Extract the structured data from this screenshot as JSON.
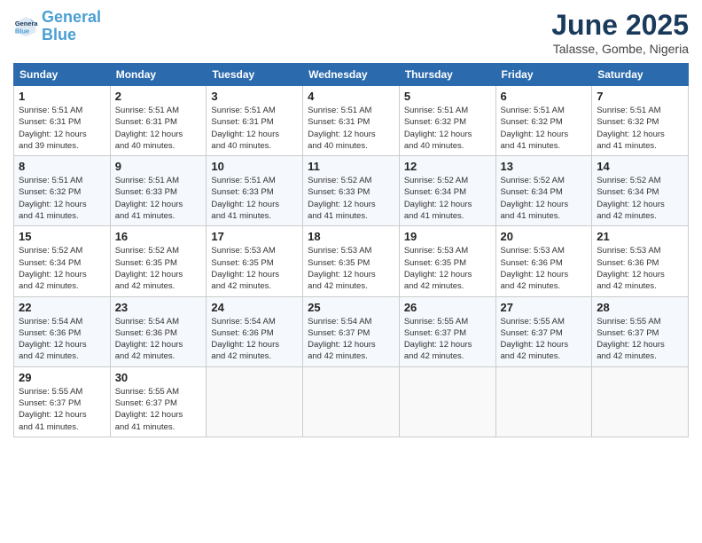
{
  "header": {
    "logo_line1": "General",
    "logo_line2": "Blue",
    "month": "June 2025",
    "location": "Talasse, Gombe, Nigeria"
  },
  "weekdays": [
    "Sunday",
    "Monday",
    "Tuesday",
    "Wednesday",
    "Thursday",
    "Friday",
    "Saturday"
  ],
  "days": [
    {
      "num": "",
      "info": ""
    },
    {
      "num": "",
      "info": ""
    },
    {
      "num": "",
      "info": ""
    },
    {
      "num": "",
      "info": ""
    },
    {
      "num": "",
      "info": ""
    },
    {
      "num": "",
      "info": ""
    },
    {
      "num": "",
      "info": ""
    },
    {
      "num": "1",
      "info": "Sunrise: 5:51 AM\nSunset: 6:31 PM\nDaylight: 12 hours\nand 39 minutes."
    },
    {
      "num": "2",
      "info": "Sunrise: 5:51 AM\nSunset: 6:31 PM\nDaylight: 12 hours\nand 40 minutes."
    },
    {
      "num": "3",
      "info": "Sunrise: 5:51 AM\nSunset: 6:31 PM\nDaylight: 12 hours\nand 40 minutes."
    },
    {
      "num": "4",
      "info": "Sunrise: 5:51 AM\nSunset: 6:31 PM\nDaylight: 12 hours\nand 40 minutes."
    },
    {
      "num": "5",
      "info": "Sunrise: 5:51 AM\nSunset: 6:32 PM\nDaylight: 12 hours\nand 40 minutes."
    },
    {
      "num": "6",
      "info": "Sunrise: 5:51 AM\nSunset: 6:32 PM\nDaylight: 12 hours\nand 41 minutes."
    },
    {
      "num": "7",
      "info": "Sunrise: 5:51 AM\nSunset: 6:32 PM\nDaylight: 12 hours\nand 41 minutes."
    },
    {
      "num": "8",
      "info": "Sunrise: 5:51 AM\nSunset: 6:32 PM\nDaylight: 12 hours\nand 41 minutes."
    },
    {
      "num": "9",
      "info": "Sunrise: 5:51 AM\nSunset: 6:33 PM\nDaylight: 12 hours\nand 41 minutes."
    },
    {
      "num": "10",
      "info": "Sunrise: 5:51 AM\nSunset: 6:33 PM\nDaylight: 12 hours\nand 41 minutes."
    },
    {
      "num": "11",
      "info": "Sunrise: 5:52 AM\nSunset: 6:33 PM\nDaylight: 12 hours\nand 41 minutes."
    },
    {
      "num": "12",
      "info": "Sunrise: 5:52 AM\nSunset: 6:34 PM\nDaylight: 12 hours\nand 41 minutes."
    },
    {
      "num": "13",
      "info": "Sunrise: 5:52 AM\nSunset: 6:34 PM\nDaylight: 12 hours\nand 41 minutes."
    },
    {
      "num": "14",
      "info": "Sunrise: 5:52 AM\nSunset: 6:34 PM\nDaylight: 12 hours\nand 42 minutes."
    },
    {
      "num": "15",
      "info": "Sunrise: 5:52 AM\nSunset: 6:34 PM\nDaylight: 12 hours\nand 42 minutes."
    },
    {
      "num": "16",
      "info": "Sunrise: 5:52 AM\nSunset: 6:35 PM\nDaylight: 12 hours\nand 42 minutes."
    },
    {
      "num": "17",
      "info": "Sunrise: 5:53 AM\nSunset: 6:35 PM\nDaylight: 12 hours\nand 42 minutes."
    },
    {
      "num": "18",
      "info": "Sunrise: 5:53 AM\nSunset: 6:35 PM\nDaylight: 12 hours\nand 42 minutes."
    },
    {
      "num": "19",
      "info": "Sunrise: 5:53 AM\nSunset: 6:35 PM\nDaylight: 12 hours\nand 42 minutes."
    },
    {
      "num": "20",
      "info": "Sunrise: 5:53 AM\nSunset: 6:36 PM\nDaylight: 12 hours\nand 42 minutes."
    },
    {
      "num": "21",
      "info": "Sunrise: 5:53 AM\nSunset: 6:36 PM\nDaylight: 12 hours\nand 42 minutes."
    },
    {
      "num": "22",
      "info": "Sunrise: 5:54 AM\nSunset: 6:36 PM\nDaylight: 12 hours\nand 42 minutes."
    },
    {
      "num": "23",
      "info": "Sunrise: 5:54 AM\nSunset: 6:36 PM\nDaylight: 12 hours\nand 42 minutes."
    },
    {
      "num": "24",
      "info": "Sunrise: 5:54 AM\nSunset: 6:36 PM\nDaylight: 12 hours\nand 42 minutes."
    },
    {
      "num": "25",
      "info": "Sunrise: 5:54 AM\nSunset: 6:37 PM\nDaylight: 12 hours\nand 42 minutes."
    },
    {
      "num": "26",
      "info": "Sunrise: 5:55 AM\nSunset: 6:37 PM\nDaylight: 12 hours\nand 42 minutes."
    },
    {
      "num": "27",
      "info": "Sunrise: 5:55 AM\nSunset: 6:37 PM\nDaylight: 12 hours\nand 42 minutes."
    },
    {
      "num": "28",
      "info": "Sunrise: 5:55 AM\nSunset: 6:37 PM\nDaylight: 12 hours\nand 42 minutes."
    },
    {
      "num": "29",
      "info": "Sunrise: 5:55 AM\nSunset: 6:37 PM\nDaylight: 12 hours\nand 41 minutes."
    },
    {
      "num": "30",
      "info": "Sunrise: 5:55 AM\nSunset: 6:37 PM\nDaylight: 12 hours\nand 41 minutes."
    },
    {
      "num": "",
      "info": ""
    },
    {
      "num": "",
      "info": ""
    },
    {
      "num": "",
      "info": ""
    },
    {
      "num": "",
      "info": ""
    },
    {
      "num": "",
      "info": ""
    }
  ]
}
